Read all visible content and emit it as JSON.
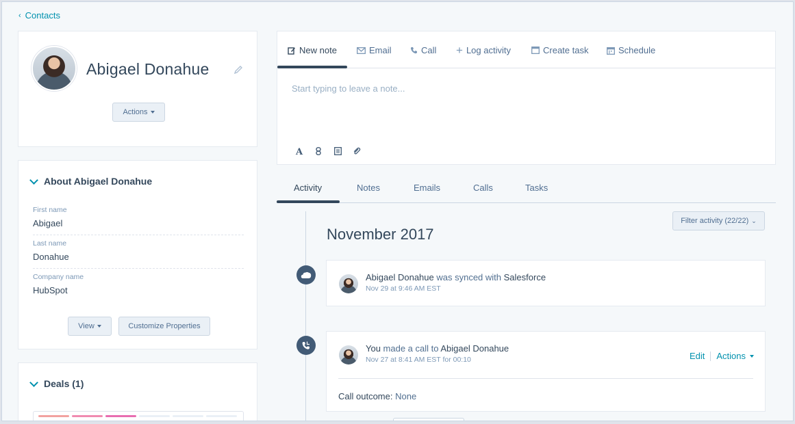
{
  "nav": {
    "back_label": "Contacts"
  },
  "profile": {
    "name": "Abigael Donahue",
    "actions_label": "Actions"
  },
  "about": {
    "heading": "About Abigael Donahue",
    "fields": [
      {
        "label": "First name",
        "value": "Abigael"
      },
      {
        "label": "Last name",
        "value": "Donahue"
      },
      {
        "label": "Company name",
        "value": "HubSpot"
      }
    ],
    "view_label": "View",
    "customize_label": "Customize Properties"
  },
  "deals": {
    "heading": "Deals (1)",
    "stage_colors": [
      "#f2a2a0",
      "#f08bb0",
      "#e86db0",
      "#eaf0f6",
      "#eaf0f6",
      "#eaf0f6"
    ]
  },
  "composer": {
    "tabs": [
      {
        "label": "New note",
        "icon": "pencil-note-icon"
      },
      {
        "label": "Email",
        "icon": "envelope-icon"
      },
      {
        "label": "Call",
        "icon": "phone-icon"
      },
      {
        "label": "Log activity",
        "icon": "plus-icon"
      },
      {
        "label": "Create task",
        "icon": "task-icon"
      },
      {
        "label": "Schedule",
        "icon": "calendar-icon"
      }
    ],
    "placeholder": "Start typing to leave a note...",
    "toolbar": [
      "text-style-icon",
      "link-icon",
      "snippet-icon",
      "attachment-icon"
    ]
  },
  "activity": {
    "tabs": [
      "Activity",
      "Notes",
      "Emails",
      "Calls",
      "Tasks"
    ],
    "filter_label": "Filter activity (22/22)",
    "month": "November 2017",
    "events": [
      {
        "icon": "salesforce-cloud-icon",
        "actor": "Abigael Donahue",
        "verb": " was synced with ",
        "target": "Salesforce",
        "time": "Nov 29 at 9:46 AM EST"
      },
      {
        "icon": "phone-call-icon",
        "actor": "You",
        "verb": " made a call to ",
        "target": "Abigael Donahue",
        "time": "Nov 27 at 8:41 AM EST for 00:10",
        "edit_label": "Edit",
        "actions_label": "Actions",
        "outcome_label": "Call outcome:",
        "outcome_value": " None"
      }
    ]
  },
  "colors": {
    "accent": "#0091ae",
    "text_dark": "#33475b",
    "timeline_icon": "#425b76"
  }
}
